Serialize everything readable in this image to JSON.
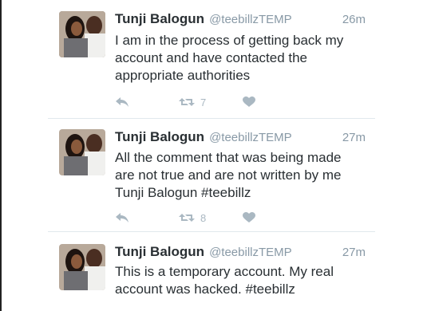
{
  "tweets": [
    {
      "name": "Tunji Balogun",
      "handle": "@teebillzTEMP",
      "time": "26m",
      "lines": [
        "I am in the process of getting back my",
        "account and have contacted the",
        "appropriate authorities"
      ],
      "retweets": "7",
      "icons": [
        "reply-icon",
        "retweet-icon",
        "heart-icon"
      ]
    },
    {
      "name": "Tunji Balogun",
      "handle": "@teebillzTEMP",
      "time": "27m",
      "lines": [
        "All the comment that was being made",
        "are not true and are not written by me",
        "Tunji Balogun #teebillz"
      ],
      "retweets": "8",
      "icons": [
        "reply-icon",
        "retweet-icon",
        "heart-icon"
      ]
    },
    {
      "name": "Tunji Balogun",
      "handle": "@teebillzTEMP",
      "time": "27m",
      "lines": [
        "This is a temporary account. My real",
        "account was hacked. #teebillz"
      ]
    }
  ],
  "colors": {
    "text": "#292f33",
    "meta": "#8899a6",
    "action": "#aab8c2",
    "divider": "#e1e8ed"
  }
}
